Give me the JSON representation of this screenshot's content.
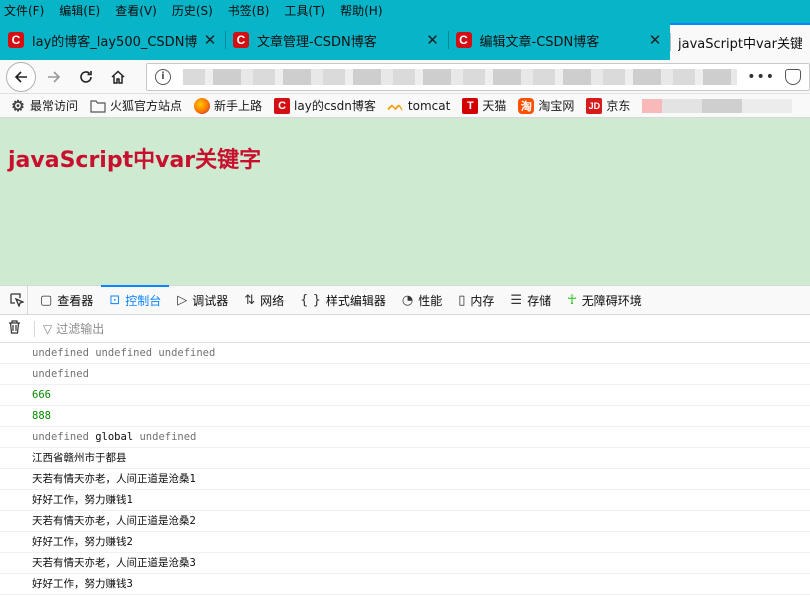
{
  "menu": [
    "文件(F)",
    "编辑(E)",
    "查看(V)",
    "历史(S)",
    "书签(B)",
    "工具(T)",
    "帮助(H)"
  ],
  "tabs": [
    {
      "label": "lay的博客_lay500_CSDN博客",
      "icon": "C"
    },
    {
      "label": "文章管理-CSDN博客",
      "icon": "C"
    },
    {
      "label": "编辑文章-CSDN博客",
      "icon": "C"
    },
    {
      "label": "javaScript中var关键字"
    }
  ],
  "bookmarks": [
    {
      "label": "最常访问",
      "icon": "gear-icon"
    },
    {
      "label": "火狐官方站点",
      "icon": "folder-icon"
    },
    {
      "label": "新手上路",
      "icon": "firefox-icon"
    },
    {
      "label": "lay的csdn博客",
      "icon": "C"
    },
    {
      "label": "tomcat",
      "icon": "tomcat-icon"
    },
    {
      "label": "天猫",
      "icon": "T"
    },
    {
      "label": "淘宝网",
      "icon": "淘"
    },
    {
      "label": "京东",
      "icon": "JD"
    }
  ],
  "page": {
    "heading": "javaScript中var关键字",
    "bg": "#ceead0",
    "heading_color": "#c8102e"
  },
  "devtools": {
    "tabs": [
      "查看器",
      "控制台",
      "调试器",
      "网络",
      "样式编辑器",
      "性能",
      "内存",
      "存储",
      "无障碍环境"
    ],
    "active_tab": "控制台",
    "filter_placeholder": "过滤输出"
  },
  "console": [
    "undefined undefined undefined",
    "undefined",
    "666",
    "888",
    "undefined global undefined",
    "江西省赣州市于都县",
    "天若有情天亦老，人间正道是沧桑1",
    "好好工作，努力赚钱1",
    "天若有情天亦老，人间正道是沧桑2",
    "好好工作，努力赚钱2",
    "天若有情天亦老，人间正道是沧桑3",
    "好好工作，努力赚钱3"
  ]
}
